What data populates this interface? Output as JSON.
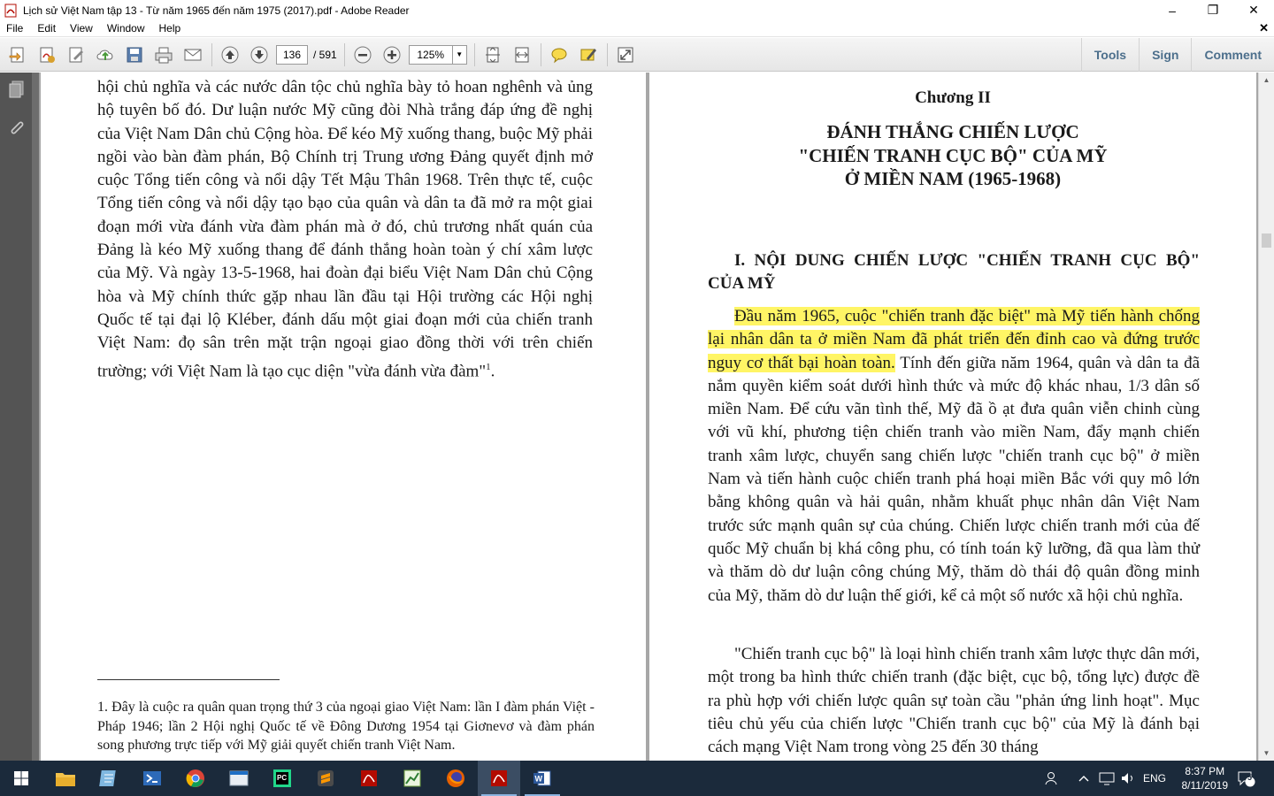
{
  "window": {
    "title": "Lịch sử Việt Nam tập 13 - Từ năm 1965 đến năm 1975 (2017).pdf - Adobe Reader",
    "minimize": "‒",
    "maximize": "❐",
    "close": "✕"
  },
  "menu": {
    "items": [
      "File",
      "Edit",
      "View",
      "Window",
      "Help"
    ],
    "close_doc": "✕"
  },
  "toolbar": {
    "page_current": "136",
    "page_total": "/ 591",
    "zoom": "125%",
    "tools": "Tools",
    "sign": "Sign",
    "comment": "Comment"
  },
  "left_page": {
    "lines": [
      "hội chủ nghĩa và các nước dân tộc chủ nghĩa bày tỏ hoan nghênh và ủng hộ tuyên bố đó. Dư luận nước Mỹ cũng đòi Nhà trắng đáp ứng đề nghị của Việt Nam Dân chủ Cộng hòa. Để kéo Mỹ xuống thang, buộc Mỹ phải ngồi vào bàn đàm phán, Bộ Chính trị Trung ương Đảng quyết định mở cuộc Tổng tiến công và nổi dậy Tết Mậu Thân 1968. Trên thực tế, cuộc Tổng tiến công và nổi dậy tạo bạo của quân và dân ta đã mở ra một giai đoạn mới vừa đánh vừa đàm phán mà ở đó, chủ trương nhất quán của Đảng là kéo Mỹ xuống thang để đánh thắng hoàn toàn ý chí xâm lược của Mỹ. Và ngày 13-5-1968, hai đoàn đại biểu Việt Nam Dân chủ Cộng hòa và Mỹ chính thức gặp nhau lần đầu tại Hội trường các Hội nghị Quốc tế tại đại lộ Kléber, đánh dấu một giai đoạn mới của chiến tranh Việt Nam: đọ sân trên mặt trận ngoại giao đồng thời với trên chiến trường; với Việt Nam là tạo cục diện \"vừa đánh vừa đàm\""
    ],
    "footnote_ref": "1",
    "footnote_end": ".",
    "footnote": "1. Đây là cuộc ra quân quan trọng thứ 3 của ngoại giao Việt Nam: lần I đàm phán Việt - Pháp 1946; lần 2 Hội nghị Quốc tế về Đông Dương 1954 tại Giơnevơ và đàm phán song phương trực tiếp với Mỹ giải quyết chiến tranh Việt Nam."
  },
  "right_page": {
    "chapter": "Chương II",
    "title_line1": "ĐÁNH THẮNG CHIẾN LƯỢC",
    "title_line2": "\"CHIẾN TRANH CỤC BỘ\" CỦA MỸ",
    "title_line3": "Ở MIỀN NAM (1965-1968)",
    "section_heading": "I. NỘI DUNG CHIẾN LƯỢC \"CHIẾN TRANH CỤC BỘ\" CỦA MỸ",
    "para1_highlighted": "Đầu năm 1965, cuộc \"chiến tranh đặc biệt\" mà Mỹ tiến hành chống lại nhân dân ta ở miền Nam đã phát triển đến đỉnh cao và đứng trước nguy cơ thất bại hoàn toàn.",
    "para1_rest": " Tính đến giữa năm 1964, quân và dân ta đã nắm quyền kiểm soát dưới hình thức và mức độ khác nhau, 1/3 dân số miền Nam. Để cứu vãn tình thế, Mỹ đã ồ ạt đưa quân viễn chinh cùng với vũ khí, phương tiện chiến tranh vào miền Nam, đẩy mạnh chiến tranh xâm lược, chuyển sang chiến lược \"chiến tranh cục bộ\" ở miền Nam và tiến hành cuộc chiến tranh phá hoại miền Bắc với quy mô lớn bằng không quân và hải quân, nhằm khuất phục nhân dân Việt Nam trước sức mạnh quân sự của chúng. Chiến lược chiến tranh mới của đế quốc Mỹ chuẩn bị khá công phu, có tính toán kỹ lưỡng, đã qua làm thử và thăm dò dư luận công chúng Mỹ, thăm dò thái độ quân đồng minh của Mỹ, thăm dò dư luận thế giới, kể cả một số nước xã hội chủ nghĩa.",
    "para2": "\"Chiến tranh cục bộ\" là loại hình chiến tranh xâm lược thực dân mới, một trong ba hình thức chiến tranh (đặc biệt, cục bộ, tổng lực) được đề ra phù hợp với chiến lược quân sự toàn cầu \"phản ứng linh hoạt\". Mục tiêu chủ yếu của chiến lược \"Chiến tranh cục bộ\" của Mỹ là đánh bại cách mạng Việt Nam trong vòng 25 đến 30 tháng"
  },
  "taskbar": {
    "language": "ENG",
    "time": "8:37 PM",
    "date": "8/11/2019",
    "notifications": "5"
  },
  "colors": {
    "highlight": "#fff565",
    "taskbar": "#1b2a3b",
    "pane_link": "#4c6f8c"
  }
}
